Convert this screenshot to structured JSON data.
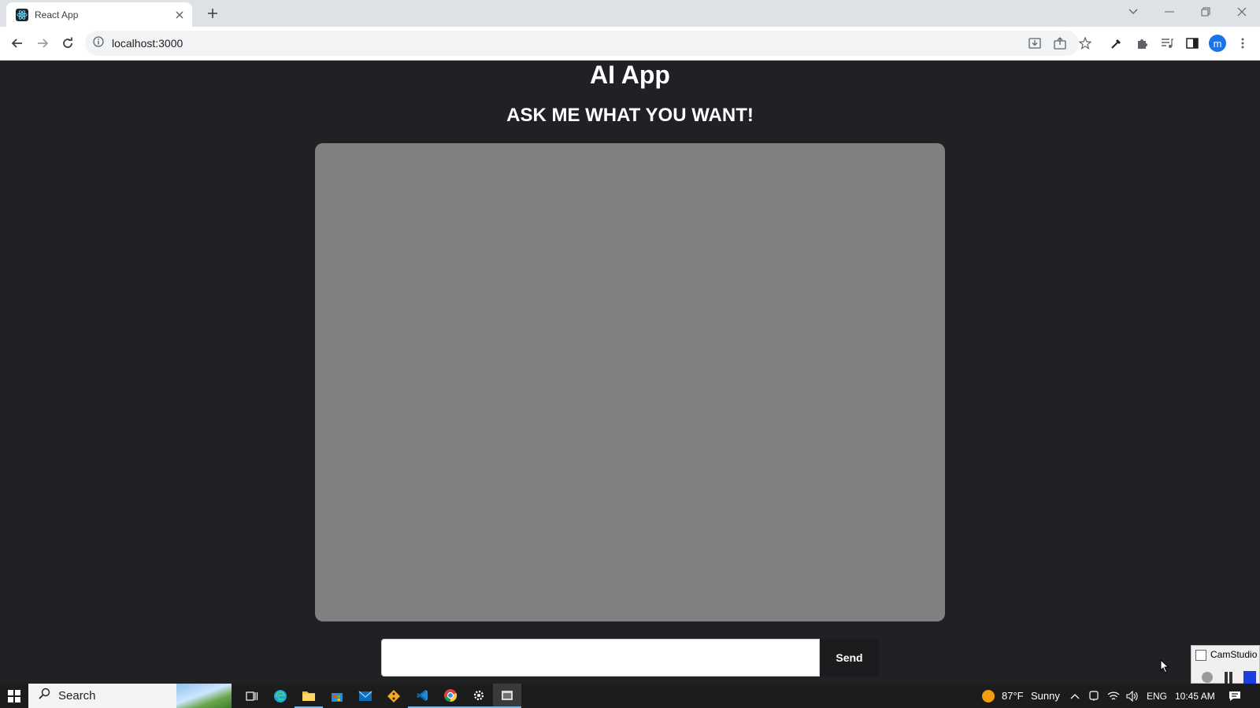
{
  "browser": {
    "tab_title": "React App",
    "url": "localhost:3000"
  },
  "page": {
    "title": "AI App",
    "subtitle": "ASK ME WHAT YOU WANT!",
    "input_value": "",
    "send_label": "Send"
  },
  "overlay": {
    "camstudio_label": "CamStudio"
  },
  "taskbar": {
    "search_label": "Search",
    "weather_temp": "87°F",
    "weather_condition": "Sunny",
    "language": "ENG",
    "time": "10:45 AM"
  },
  "colors": {
    "page_bg": "#202124",
    "chat_box_bg": "#808080",
    "send_bg": "#1b1c1e"
  }
}
